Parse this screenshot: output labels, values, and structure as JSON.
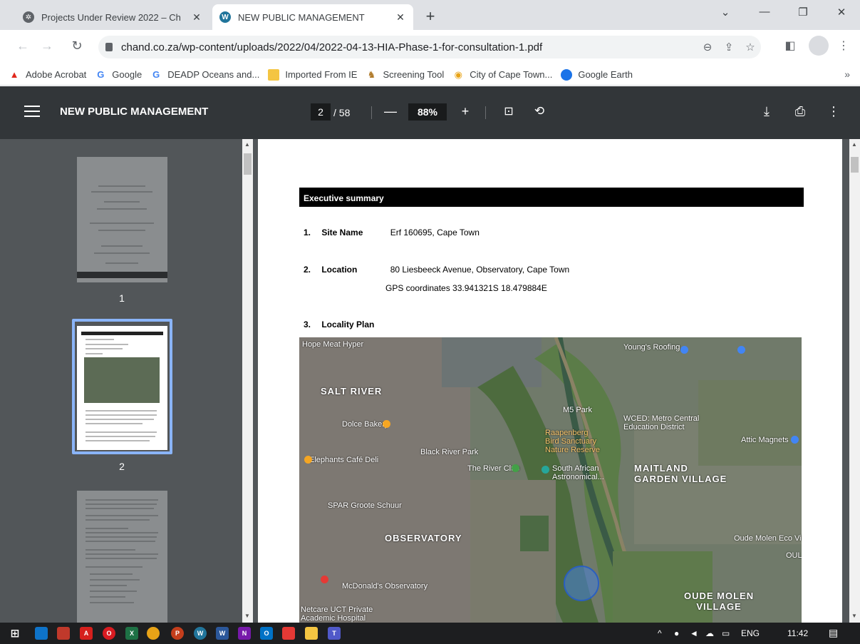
{
  "browser": {
    "tabs": [
      {
        "title": "Projects Under Review 2022 – Ch",
        "icon": "gear-favicon",
        "active": false
      },
      {
        "title": "NEW PUBLIC MANAGEMENT",
        "icon": "wordpress-favicon",
        "active": true
      }
    ],
    "new_tab": "+",
    "window_controls": {
      "collapse": "⌄",
      "minimize": "—",
      "restore": "❐",
      "close": "✕"
    },
    "url": "chand.co.za/wp-content/uploads/2022/04/2022-04-13-HIA-Phase-1-for-consultation-1.pdf",
    "bookmarks": [
      {
        "label": "Adobe Acrobat",
        "icon": "acrobat-icon",
        "color": "#e0281c"
      },
      {
        "label": "Google",
        "icon": "google-icon",
        "color": "#4285f4"
      },
      {
        "label": "DEADP Oceans and...",
        "icon": "google-icon",
        "color": "#4285f4"
      },
      {
        "label": "Imported From IE",
        "icon": "folder-icon",
        "color": "#f4c542"
      },
      {
        "label": "Screening Tool",
        "icon": "crest-icon",
        "color": "#b07a2a"
      },
      {
        "label": "City of Cape Town...",
        "icon": "city-icon",
        "color": "#e8a317"
      },
      {
        "label": "Google Earth",
        "icon": "earth-icon",
        "color": "#1a73e8"
      }
    ],
    "bookmarks_more": "»"
  },
  "pdf": {
    "title": "NEW PUBLIC MANAGEMENT",
    "current_page": "2",
    "total_pages": "/ 58",
    "zoom": "88%",
    "zoom_out": "—",
    "zoom_in": "+",
    "thumbnails": [
      {
        "number": "1"
      },
      {
        "number": "2"
      }
    ],
    "page": {
      "heading": "Executive summary",
      "items": [
        {
          "num": "1.",
          "label": "Site Name",
          "value": "Erf 160695, Cape Town"
        },
        {
          "num": "2.",
          "label": "Location",
          "value": "80 Liesbeeck Avenue, Observatory, Cape Town",
          "value2": "GPS coordinates 33.941321S 18.479884E"
        },
        {
          "num": "3.",
          "label": "Locality Plan"
        }
      ],
      "map_labels": {
        "hope_meat": "Hope Meat Hyper",
        "salt_river": "SALT RIVER",
        "dolce": "Dolce Bakery",
        "black_river": "Black River Park",
        "cafe": "Elephants Café Deli",
        "raapenberg": "Raapenberg\nBird Sanctuary\nNature Reserve",
        "m5_park": "M5 Park",
        "wcedmc": "WCED: Metro Central\nEducation District",
        "maitland_gv": "MAITLAND\nGARDEN VILLAGE",
        "attic": "Attic Magnets",
        "river_club": "The River Club",
        "saao": "South African\nAstronomical...",
        "spar": "SPAR Groote Schuur",
        "observatory": "OBSERVATORY",
        "mcdonalds": "McDonald's Observatory",
        "oude_molen_ev": "Oude Molen Eco Village",
        "oude_molen": "OUDE MOLEN\nVILLAGE",
        "youngs": "Young's Roofing",
        "hospital": "Netcare UCT Private\nAcademic Hospital",
        "oudemark": "OUL"
      }
    }
  },
  "taskbar": {
    "apps": [
      {
        "name": "windows-start",
        "color": "#ffffff"
      },
      {
        "name": "app-blue",
        "color": "#0e73c9"
      },
      {
        "name": "app-red-square",
        "color": "#c0392b"
      },
      {
        "name": "acrobat",
        "color": "#d6201d"
      },
      {
        "name": "opera",
        "color": "#d81b21"
      },
      {
        "name": "excel",
        "color": "#1e7145"
      },
      {
        "name": "chrome",
        "color": "#e8a317"
      },
      {
        "name": "powerpoint",
        "color": "#c43e1c"
      },
      {
        "name": "wordpress",
        "color": "#21759b"
      },
      {
        "name": "word",
        "color": "#2b579a"
      },
      {
        "name": "onenote",
        "color": "#7719aa"
      },
      {
        "name": "outlook",
        "color": "#0072c6"
      },
      {
        "name": "anydesk",
        "color": "#e53935"
      },
      {
        "name": "file-explorer",
        "color": "#f4c542"
      },
      {
        "name": "teams",
        "color": "#5059c9"
      }
    ],
    "language": "ENG",
    "time": "11:42"
  }
}
